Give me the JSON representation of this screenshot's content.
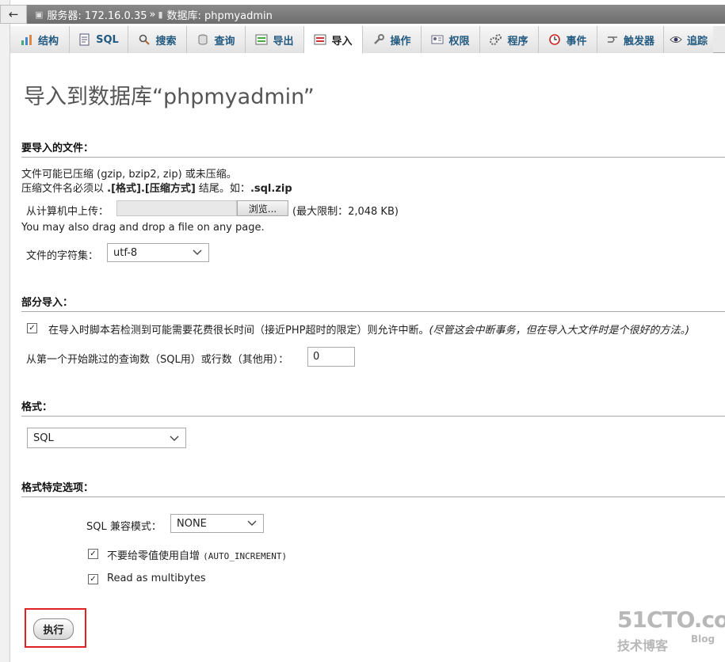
{
  "breadcrumb": {
    "server_label": "服务器: 172.16.0.35",
    "separator": "»",
    "database_label": "数据库: phpmyadmin"
  },
  "tabs": [
    {
      "label": "结构",
      "icon": "structure-icon"
    },
    {
      "label": "SQL",
      "icon": "sql-icon"
    },
    {
      "label": "搜索",
      "icon": "search-icon"
    },
    {
      "label": "查询",
      "icon": "query-icon"
    },
    {
      "label": "导出",
      "icon": "export-icon"
    },
    {
      "label": "导入",
      "icon": "import-icon",
      "active": true
    },
    {
      "label": "操作",
      "icon": "wrench-icon"
    },
    {
      "label": "权限",
      "icon": "privileges-icon"
    },
    {
      "label": "程序",
      "icon": "routines-icon"
    },
    {
      "label": "事件",
      "icon": "clock-icon"
    },
    {
      "label": "触发器",
      "icon": "triggers-icon"
    },
    {
      "label": "追踪",
      "icon": "eye-icon"
    }
  ],
  "page_title": "导入到数据库“phpmyadmin”",
  "file_section": {
    "heading": "要导入的文件：",
    "compress_note": "文件可能已压缩 (gzip, bzip2, zip) 或未压缩。",
    "name_note_prefix": "压缩文件名必须以 ",
    "name_note_format": ".[格式].[压缩方式]",
    "name_note_mid": " 结尾。如：",
    "name_note_example": ".sql.zip",
    "upload_label": "从计算机中上传：",
    "browse_label": "浏览...",
    "max_size": "(最大限制：2,048 KB)",
    "drag_drop_note": "You may also drag and drop a file on any page.",
    "charset_label": "文件的字符集：",
    "charset_value": "utf-8"
  },
  "partial_section": {
    "heading": "部分导入：",
    "interrupt_label": "在导入时脚本若检测到可能需要花费很长时间（接近PHP超时的限定）则允许中断。",
    "interrupt_note": "(尽管这会中断事务，但在导入大文件时是个很好的方法。)",
    "interrupt_checked": true,
    "skip_label": "从第一个开始跳过的查询数（SQL用）或行数（其他用）：",
    "skip_value": "0"
  },
  "format_section": {
    "heading": "格式：",
    "format_value": "SQL"
  },
  "options_section": {
    "heading": "格式特定选项：",
    "compat_label": "SQL 兼容模式：",
    "compat_value": "NONE",
    "no_auto_zero_label": "不要给零值使用自增",
    "no_auto_zero_code": "(AUTO_INCREMENT)",
    "no_auto_zero_checked": true,
    "multibytes_label": "Read as multibytes",
    "multibytes_checked": true
  },
  "actions": {
    "run_label": "执行"
  },
  "watermark": {
    "site": "51CTO.com",
    "tagline": "技术博客",
    "blog": "Blog"
  },
  "colors": {
    "tab_link": "#235a81",
    "highlight_frame": "#e02222",
    "breadcrumb_bg": "#7a7a7a"
  }
}
